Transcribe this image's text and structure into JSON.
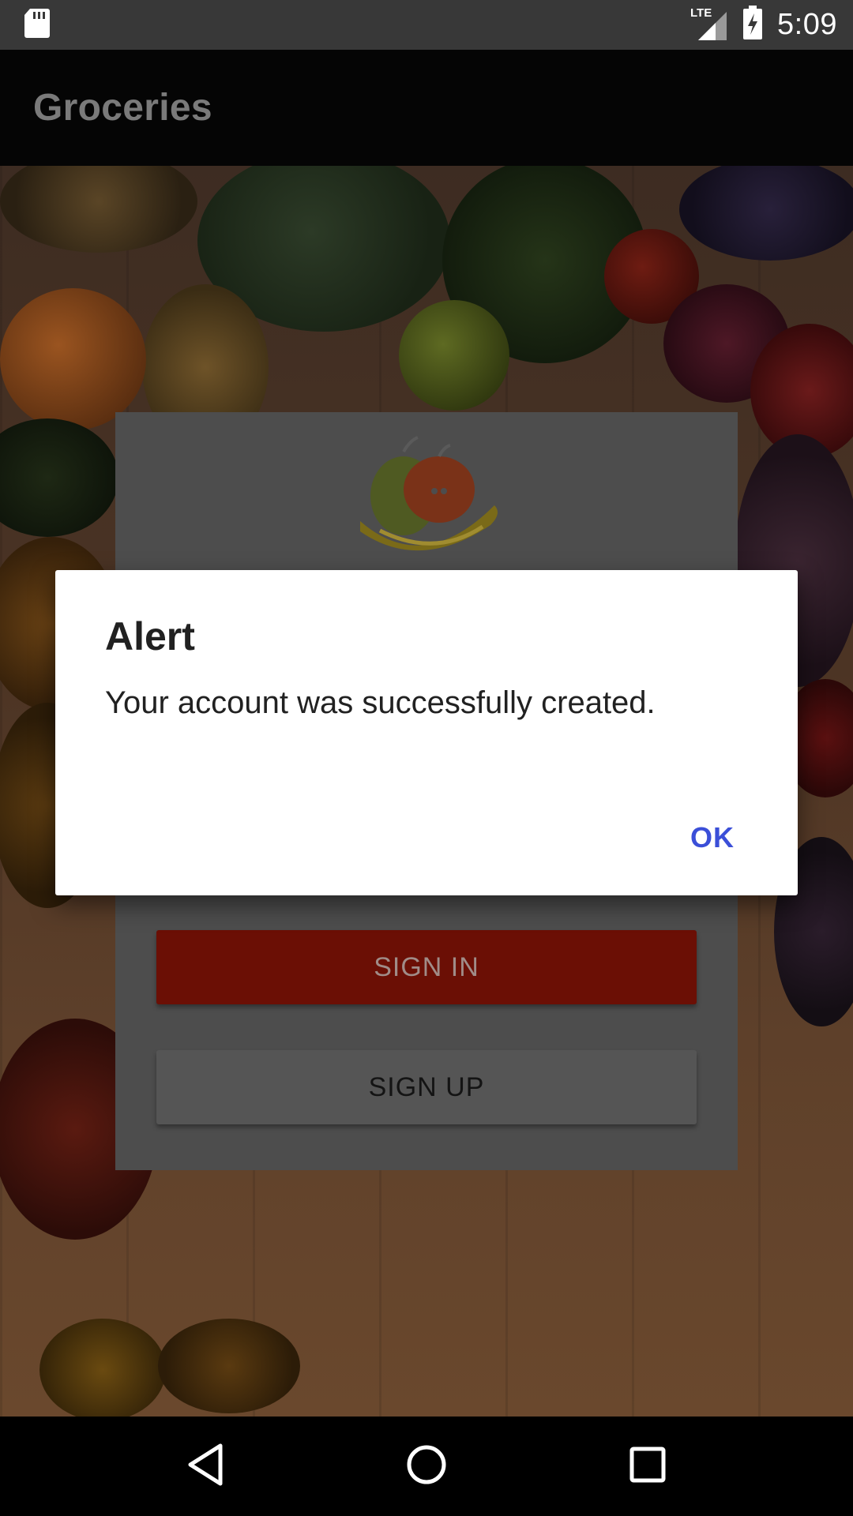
{
  "status_bar": {
    "time": "5:09",
    "network_label": "LTE",
    "icons": [
      "sd-card-icon",
      "signal-icon",
      "battery-charging-icon"
    ]
  },
  "app_bar": {
    "title": "Groceries"
  },
  "login_card": {
    "sign_in_label": "SIGN IN",
    "sign_up_label": "SIGN UP"
  },
  "dialog": {
    "title": "Alert",
    "message": "Your account was successfully created.",
    "ok_label": "OK"
  },
  "nav_bar": {
    "icons": [
      "back-icon",
      "home-icon",
      "recents-icon"
    ]
  },
  "colors": {
    "accent": "#3b4fd8",
    "sign_in": "#6b0f05",
    "status_bar": "#383838",
    "app_bar": "#050505"
  }
}
